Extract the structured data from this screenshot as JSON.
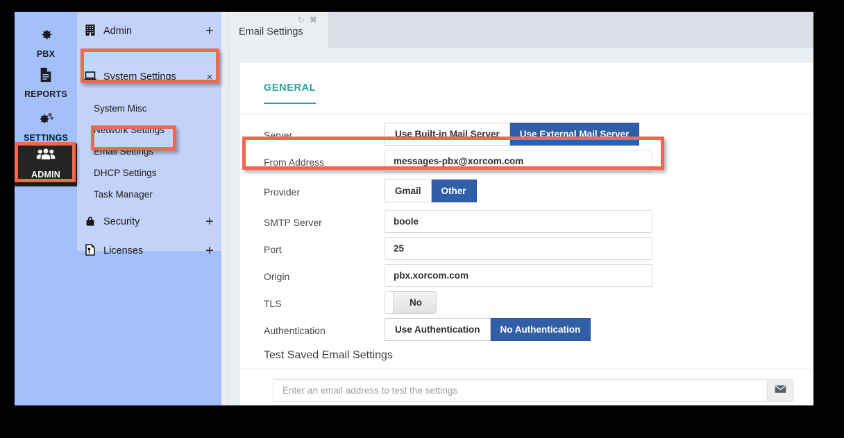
{
  "icon_rail": {
    "items": [
      {
        "label": "PBX",
        "icon": "gear-icon",
        "active": false
      },
      {
        "label": "REPORTS",
        "icon": "document-icon",
        "active": false
      },
      {
        "label": "SETTINGS",
        "icon": "gears-icon",
        "active": false
      },
      {
        "label": "ADMIN",
        "icon": "users-icon",
        "active": true
      }
    ]
  },
  "submenu": {
    "groups": {
      "admin": {
        "label": "Admin",
        "icon": "building-icon",
        "expander": "+"
      },
      "system": {
        "label": "System Settings",
        "icon": "laptop-icon",
        "close": "×"
      },
      "security": {
        "label": "Security",
        "icon": "lock-icon",
        "expander": "+"
      },
      "licenses": {
        "label": "Licenses",
        "icon": "license-icon",
        "expander": "+"
      }
    },
    "system_children": [
      "System Misc",
      "Network Settings",
      "Email Settings",
      "DHCP Settings",
      "Task Manager"
    ]
  },
  "tabbar": {
    "active_tab": "Email Settings",
    "refresh_icon": "↻",
    "close_icon": "✖"
  },
  "content": {
    "section_tab": "GENERAL",
    "rows": {
      "server": {
        "label": "Server",
        "options": [
          "Use Built-in Mail Server",
          "Use External Mail Server"
        ],
        "selected": "Use External Mail Server"
      },
      "from_address": {
        "label": "From Address",
        "value": "messages-pbx@xorcom.com"
      },
      "provider": {
        "label": "Provider",
        "options": [
          "Gmail",
          "Other"
        ],
        "selected": "Other"
      },
      "smtp_server": {
        "label": "SMTP Server",
        "value": "boole"
      },
      "port": {
        "label": "Port",
        "value": "25"
      },
      "origin": {
        "label": "Origin",
        "value": "pbx.xorcom.com"
      },
      "tls": {
        "label": "TLS",
        "value": "No"
      },
      "authentication": {
        "label": "Authentication",
        "options": [
          "Use Authentication",
          "No Authentication"
        ],
        "selected": "No Authentication"
      }
    },
    "test_section": {
      "title": "Test Saved Email Settings",
      "placeholder": "Enter an email address to test the settings",
      "value": "",
      "send_icon": "envelope-icon"
    }
  },
  "highlights": {
    "color": "#f2684e",
    "targets": [
      "ADMIN",
      "System Settings",
      "Email Settings",
      "From Address"
    ]
  },
  "colors": {
    "rail_bg": "#a4c0fb",
    "submenu_bg": "#c2d2f8",
    "active_rail": "#242424",
    "accent_teal": "#26a69a",
    "accent_blue": "#305fa8",
    "highlight_red": "#f2684e"
  }
}
